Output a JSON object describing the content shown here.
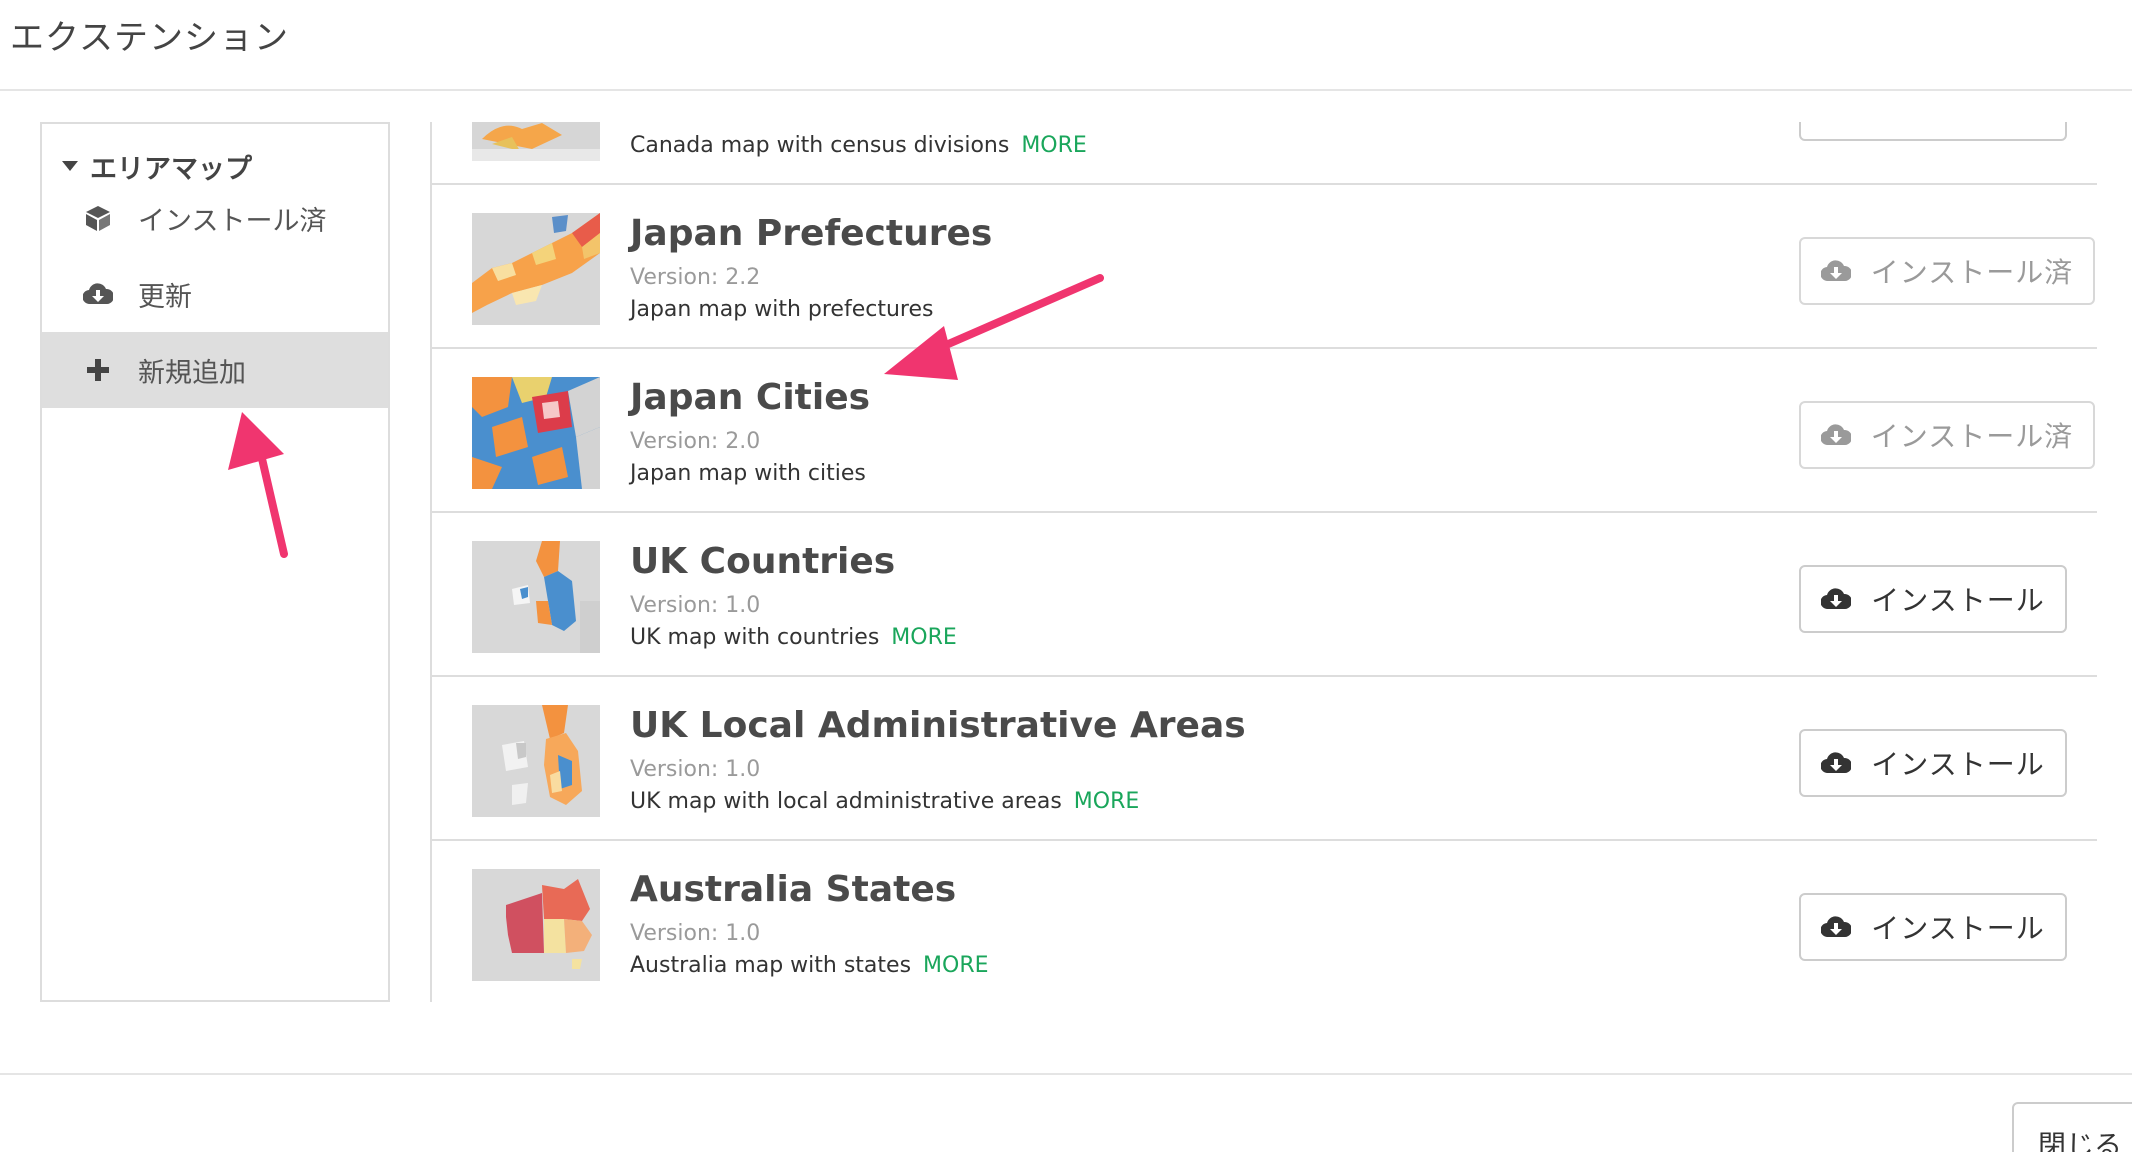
{
  "header": {
    "title": "エクステンション"
  },
  "sidebar": {
    "group_label": "エリアマップ",
    "items": [
      {
        "label": "インストール済",
        "icon": "cube-icon"
      },
      {
        "label": "更新",
        "icon": "cloud-download-icon"
      },
      {
        "label": "新規追加",
        "icon": "plus-icon",
        "active": true
      }
    ]
  },
  "extensions": [
    {
      "name": "",
      "version": "",
      "description": "Canada map with census divisions",
      "more": "MORE"
    },
    {
      "name": "Japan Prefectures",
      "version": "Version: 2.2",
      "description": "Japan map with prefectures",
      "button": "インストール済"
    },
    {
      "name": "Japan Cities",
      "version": "Version: 2.0",
      "description": "Japan map with cities",
      "button": "インストール済"
    },
    {
      "name": "UK Countries",
      "version": "Version: 1.0",
      "description": "UK map with countries",
      "more": "MORE",
      "button": "インストール"
    },
    {
      "name": "UK Local Administrative Areas",
      "version": "Version: 1.0",
      "description": "UK map with local administrative areas",
      "more": "MORE",
      "button": "インストール"
    },
    {
      "name": "Australia States",
      "version": "Version: 1.0",
      "description": "Australia map with states",
      "more": "MORE",
      "button": "インストール"
    }
  ],
  "footer": {
    "close_label": "閉じる"
  },
  "colors": {
    "more_link": "#1aa65b",
    "annotation_arrow": "#f0356f",
    "sidebar_active_bg": "#dedede"
  }
}
